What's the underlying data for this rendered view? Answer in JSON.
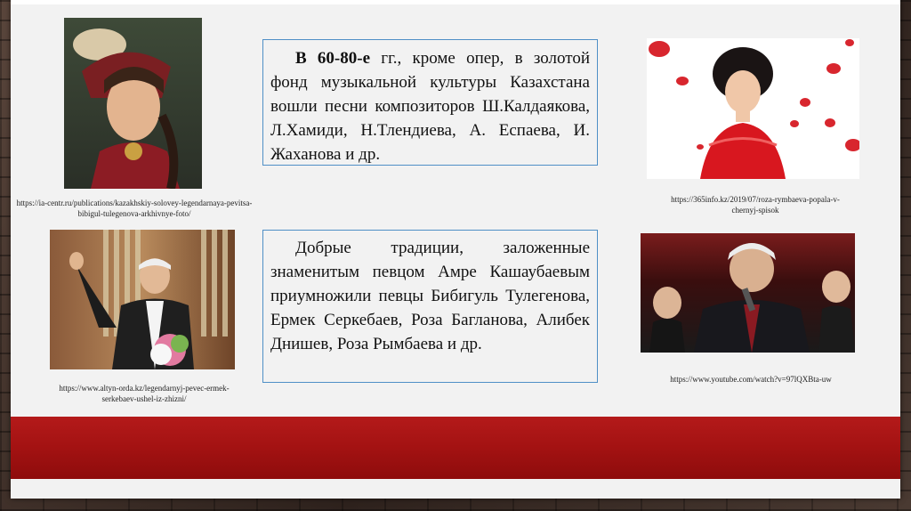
{
  "block1": {
    "bold_lead": "В 60-80-е",
    "text": " гг., кроме опер, в золотой фонд музыкальной культуры Казахстана вошли песни композиторов Ш.Калдаякова, Л.Хамиди, Н.Тлендиева, А. Еспаева, И. Жаханова и др."
  },
  "block2": {
    "text": "Добрые традиции, заложенные знаменитым певцом Амре Кашаубаевым приумножили певцы Бибигуль Тулегенова, Ермек Серкебаев, Роза Багланова, Алибек Днишев, Роза Рымбаева и др."
  },
  "captions": {
    "top_left": "https://ia-centr.ru/publications/kazakhskiy-solovey-legendarnaya-pevitsa-bibigul-tulegenova-arkhivnye-foto/",
    "top_right": "https://365info.kz/2019/07/roza-rymbaeva-popala-v-chernyj-spisok",
    "bottom_left": "https://www.altyn-orda.kz/legendarnyj-pevec-ermek-serkebaev-ushel-iz-zhizni/",
    "bottom_right": "https://www.youtube.com/watch?v=97lQXBta-uw"
  },
  "colors": {
    "accent_red": "#a31212",
    "box_border": "#4f8fc6"
  }
}
